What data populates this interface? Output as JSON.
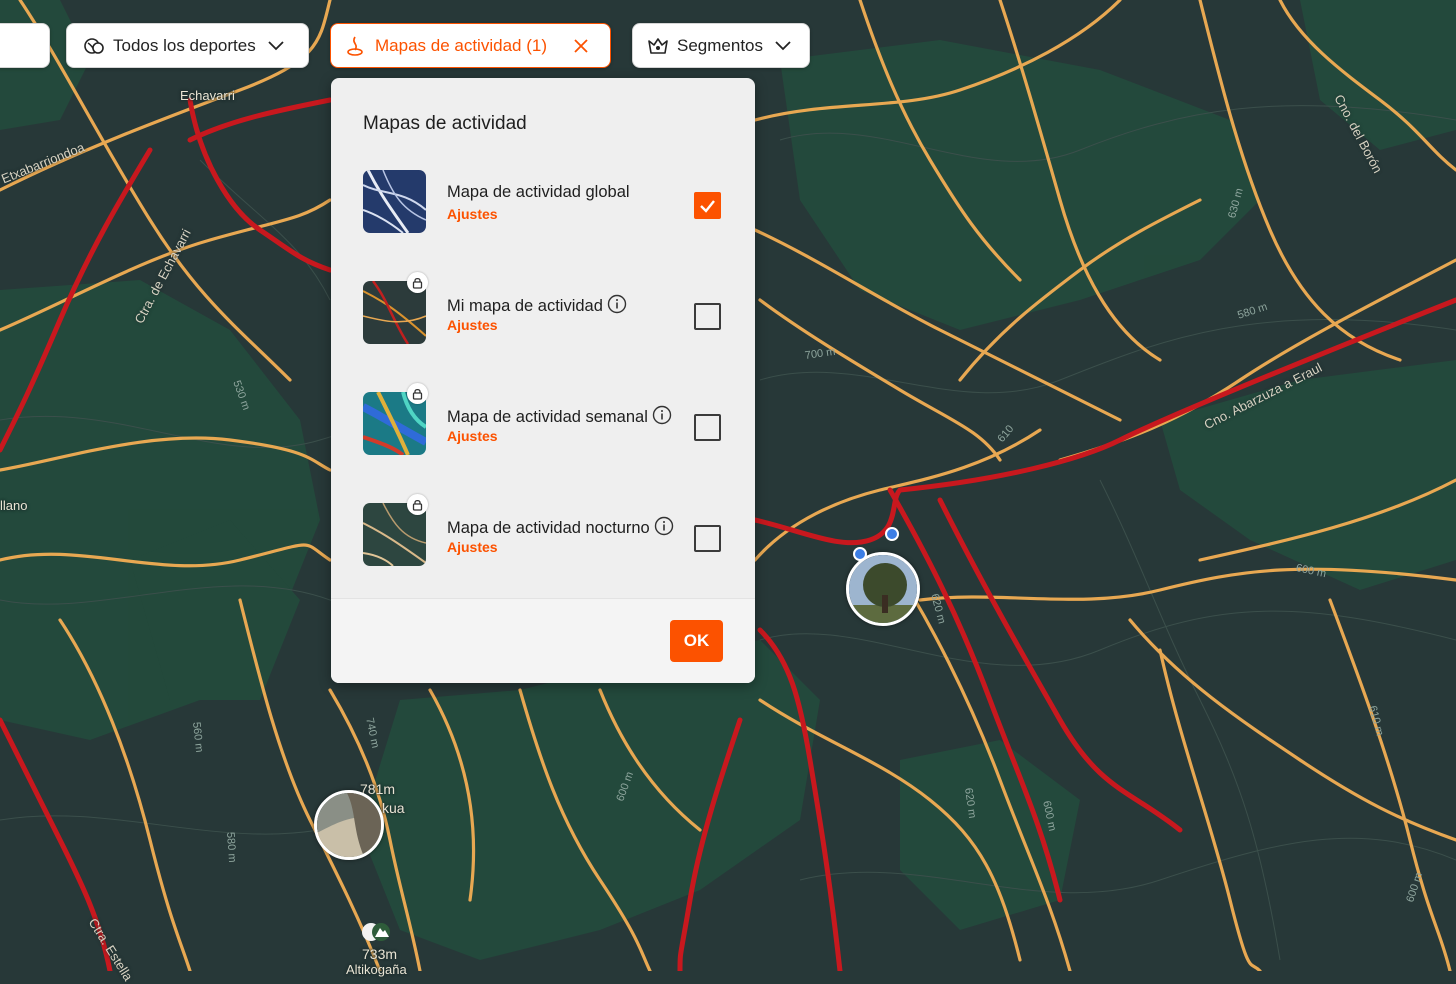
{
  "toolbar": {
    "sports_label": "Todos los deportes",
    "heatmaps_label": "Mapas de actividad (1)",
    "segments_label": "Segmentos"
  },
  "panel": {
    "title": "Mapas de actividad",
    "settings_label": "Ajustes",
    "ok_label": "OK",
    "rows": [
      {
        "label": "Mapa de actividad global",
        "checked": true,
        "locked": false,
        "info": false
      },
      {
        "label": "Mi mapa de actividad",
        "checked": false,
        "locked": true,
        "info": true
      },
      {
        "label": "Mapa de actividad semanal",
        "checked": false,
        "locked": true,
        "info": true
      },
      {
        "label": "Mapa de actividad nocturno",
        "checked": false,
        "locked": true,
        "info": true
      }
    ]
  },
  "map": {
    "places": [
      "Echavarri",
      "llano"
    ],
    "roads": [
      "Etxabarriondoa",
      "Ctra. de Echavarri",
      "Cno. Abarzuza a Eraul",
      "Cno. del Borón",
      "Ctra. Estella"
    ],
    "contours": [
      "700 m",
      "580 m",
      "530 m",
      "610",
      "600 m",
      "620 m",
      "740 m",
      "560 m",
      "580 m",
      "600 m",
      "620 m",
      "600 m",
      "610 m",
      "600 m",
      "630 m"
    ],
    "peak": {
      "elevation_top": "781m",
      "name_top": "kua",
      "elevation_bottom": "733m",
      "name_bottom": "Altikogaña"
    }
  },
  "colors": {
    "accent": "#fc5200",
    "map_bg": "#273838",
    "forest": "#234a3c",
    "trail": "#e8a852",
    "hot": "#c8181e"
  }
}
